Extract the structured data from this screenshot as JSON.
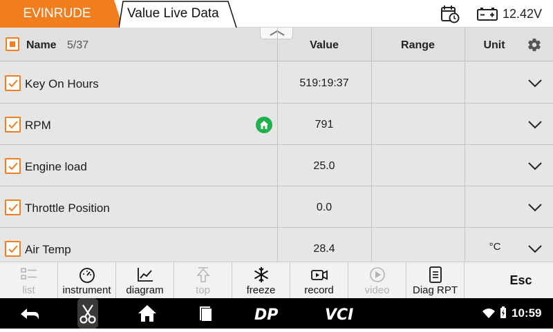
{
  "header": {
    "brand_tab": "EVINRUDE",
    "page_tab": "Value Live Data",
    "voltage": "12.42V",
    "icons": [
      "calendar-clock-icon",
      "battery-icon"
    ],
    "brand_color": "#f07d1e"
  },
  "table": {
    "columns": {
      "name": "Name",
      "count": "5/37",
      "value": "Value",
      "range": "Range",
      "unit": "Unit"
    },
    "rows": [
      {
        "name": "Key On Hours",
        "value": "519:19:37",
        "range": "",
        "unit": "",
        "checked": true
      },
      {
        "name": "RPM",
        "value": "791",
        "range": "",
        "unit": "",
        "checked": true,
        "badge": "home-icon"
      },
      {
        "name": "Engine load",
        "value": "25.0",
        "range": "",
        "unit": "",
        "checked": true
      },
      {
        "name": "Throttle Position",
        "value": "0.0",
        "range": "",
        "unit": "",
        "checked": true
      },
      {
        "name": "Air Temp",
        "value": "28.4",
        "range": "",
        "unit": "°C",
        "checked": true
      }
    ]
  },
  "toolbar": {
    "items": [
      {
        "label": "list",
        "icon": "list-icon",
        "enabled": false
      },
      {
        "label": "instrument",
        "icon": "gauge-icon",
        "enabled": true
      },
      {
        "label": "diagram",
        "icon": "line-chart-icon",
        "enabled": true
      },
      {
        "label": "top",
        "icon": "arrow-up-icon",
        "enabled": false
      },
      {
        "label": "freeze",
        "icon": "snowflake-icon",
        "enabled": true
      },
      {
        "label": "record",
        "icon": "video-camera-icon",
        "enabled": true
      },
      {
        "label": "video",
        "icon": "play-circle-icon",
        "enabled": false
      },
      {
        "label": "Diag RPT",
        "icon": "report-icon",
        "enabled": true
      }
    ],
    "esc_label": "Esc"
  },
  "navbar": {
    "app_labels": [
      "DP",
      "VCI"
    ],
    "time": "10:59",
    "icons": [
      "back-icon",
      "scissors-icon",
      "home-icon",
      "recents-icon",
      "wifi-icon",
      "battery-status-icon"
    ]
  }
}
